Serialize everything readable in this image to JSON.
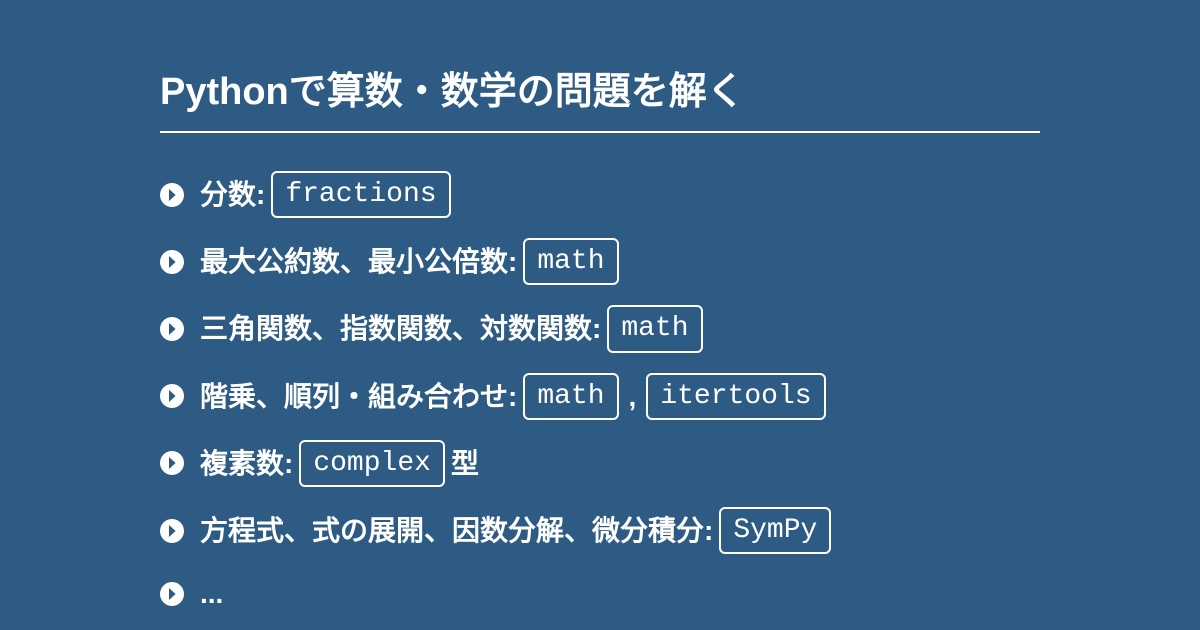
{
  "title": "Pythonで算数・数学の問題を解く",
  "items": [
    {
      "label": "分数:",
      "codes": [
        "fractions"
      ],
      "suffix": ""
    },
    {
      "label": "最大公約数、最小公倍数:",
      "codes": [
        "math"
      ],
      "suffix": ""
    },
    {
      "label": "三角関数、指数関数、対数関数:",
      "codes": [
        "math"
      ],
      "suffix": ""
    },
    {
      "label": "階乗、順列・組み合わせ:",
      "codes": [
        "math",
        "itertools"
      ],
      "suffix": ""
    },
    {
      "label": "複素数:",
      "codes": [
        "complex"
      ],
      "suffix": "型"
    },
    {
      "label": "方程式、式の展開、因数分解、微分積分:",
      "codes": [
        "SymPy"
      ],
      "suffix": ""
    },
    {
      "label": "...",
      "codes": [],
      "suffix": ""
    }
  ],
  "separator": ","
}
